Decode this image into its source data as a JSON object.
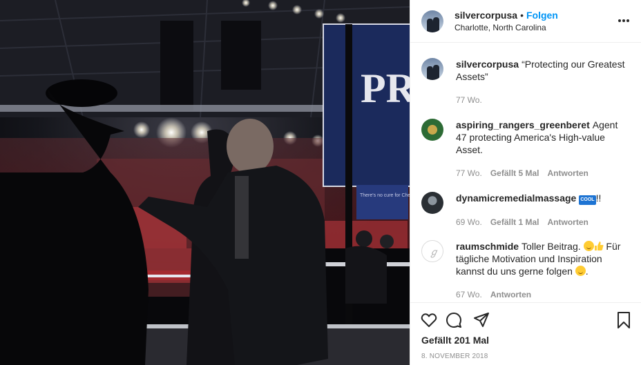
{
  "photo": {
    "alt": "",
    "sign_text": "PR",
    "sign_small_text": "There's no cure for Checkers fever"
  },
  "header": {
    "username": "silvercorpusa",
    "separator": "•",
    "follow_label": "Folgen",
    "location": "Charlotte, North Carolina",
    "more_icon": "more-horizontal-icon"
  },
  "caption": {
    "username": "silvercorpusa",
    "text": "“Protecting our Greatest Assets”",
    "age": "77 Wo."
  },
  "comments": [
    {
      "username": "aspiring_rangers_greenberet",
      "text": "Agent 47 protecting America's High-value Asset.",
      "age": "77 Wo.",
      "likes": "Gefällt 5 Mal",
      "reply": "Antworten"
    },
    {
      "username": "dynamicremedialmassage",
      "badge": "COOL",
      "text_after": "!!",
      "age": "69 Wo.",
      "likes": "Gefällt 1 Mal",
      "reply": "Antworten"
    },
    {
      "username": "raumschmide",
      "text_part1": "Toller Beitrag.",
      "text_part2": "Für tägliche Motivation und Inspiration kannst du uns gerne folgen",
      "text_end": ".",
      "age": "67 Wo.",
      "reply": "Antworten"
    }
  ],
  "footer": {
    "icons": [
      "heart-icon",
      "comment-icon",
      "share-icon",
      "bookmark-icon"
    ],
    "likes_total": "Gefällt 201 Mal",
    "date": "8. NOVEMBER 2018"
  },
  "colors": {
    "link_blue": "#0095f6",
    "text": "#262626",
    "muted": "#8e8e8e",
    "border": "#efefef"
  }
}
